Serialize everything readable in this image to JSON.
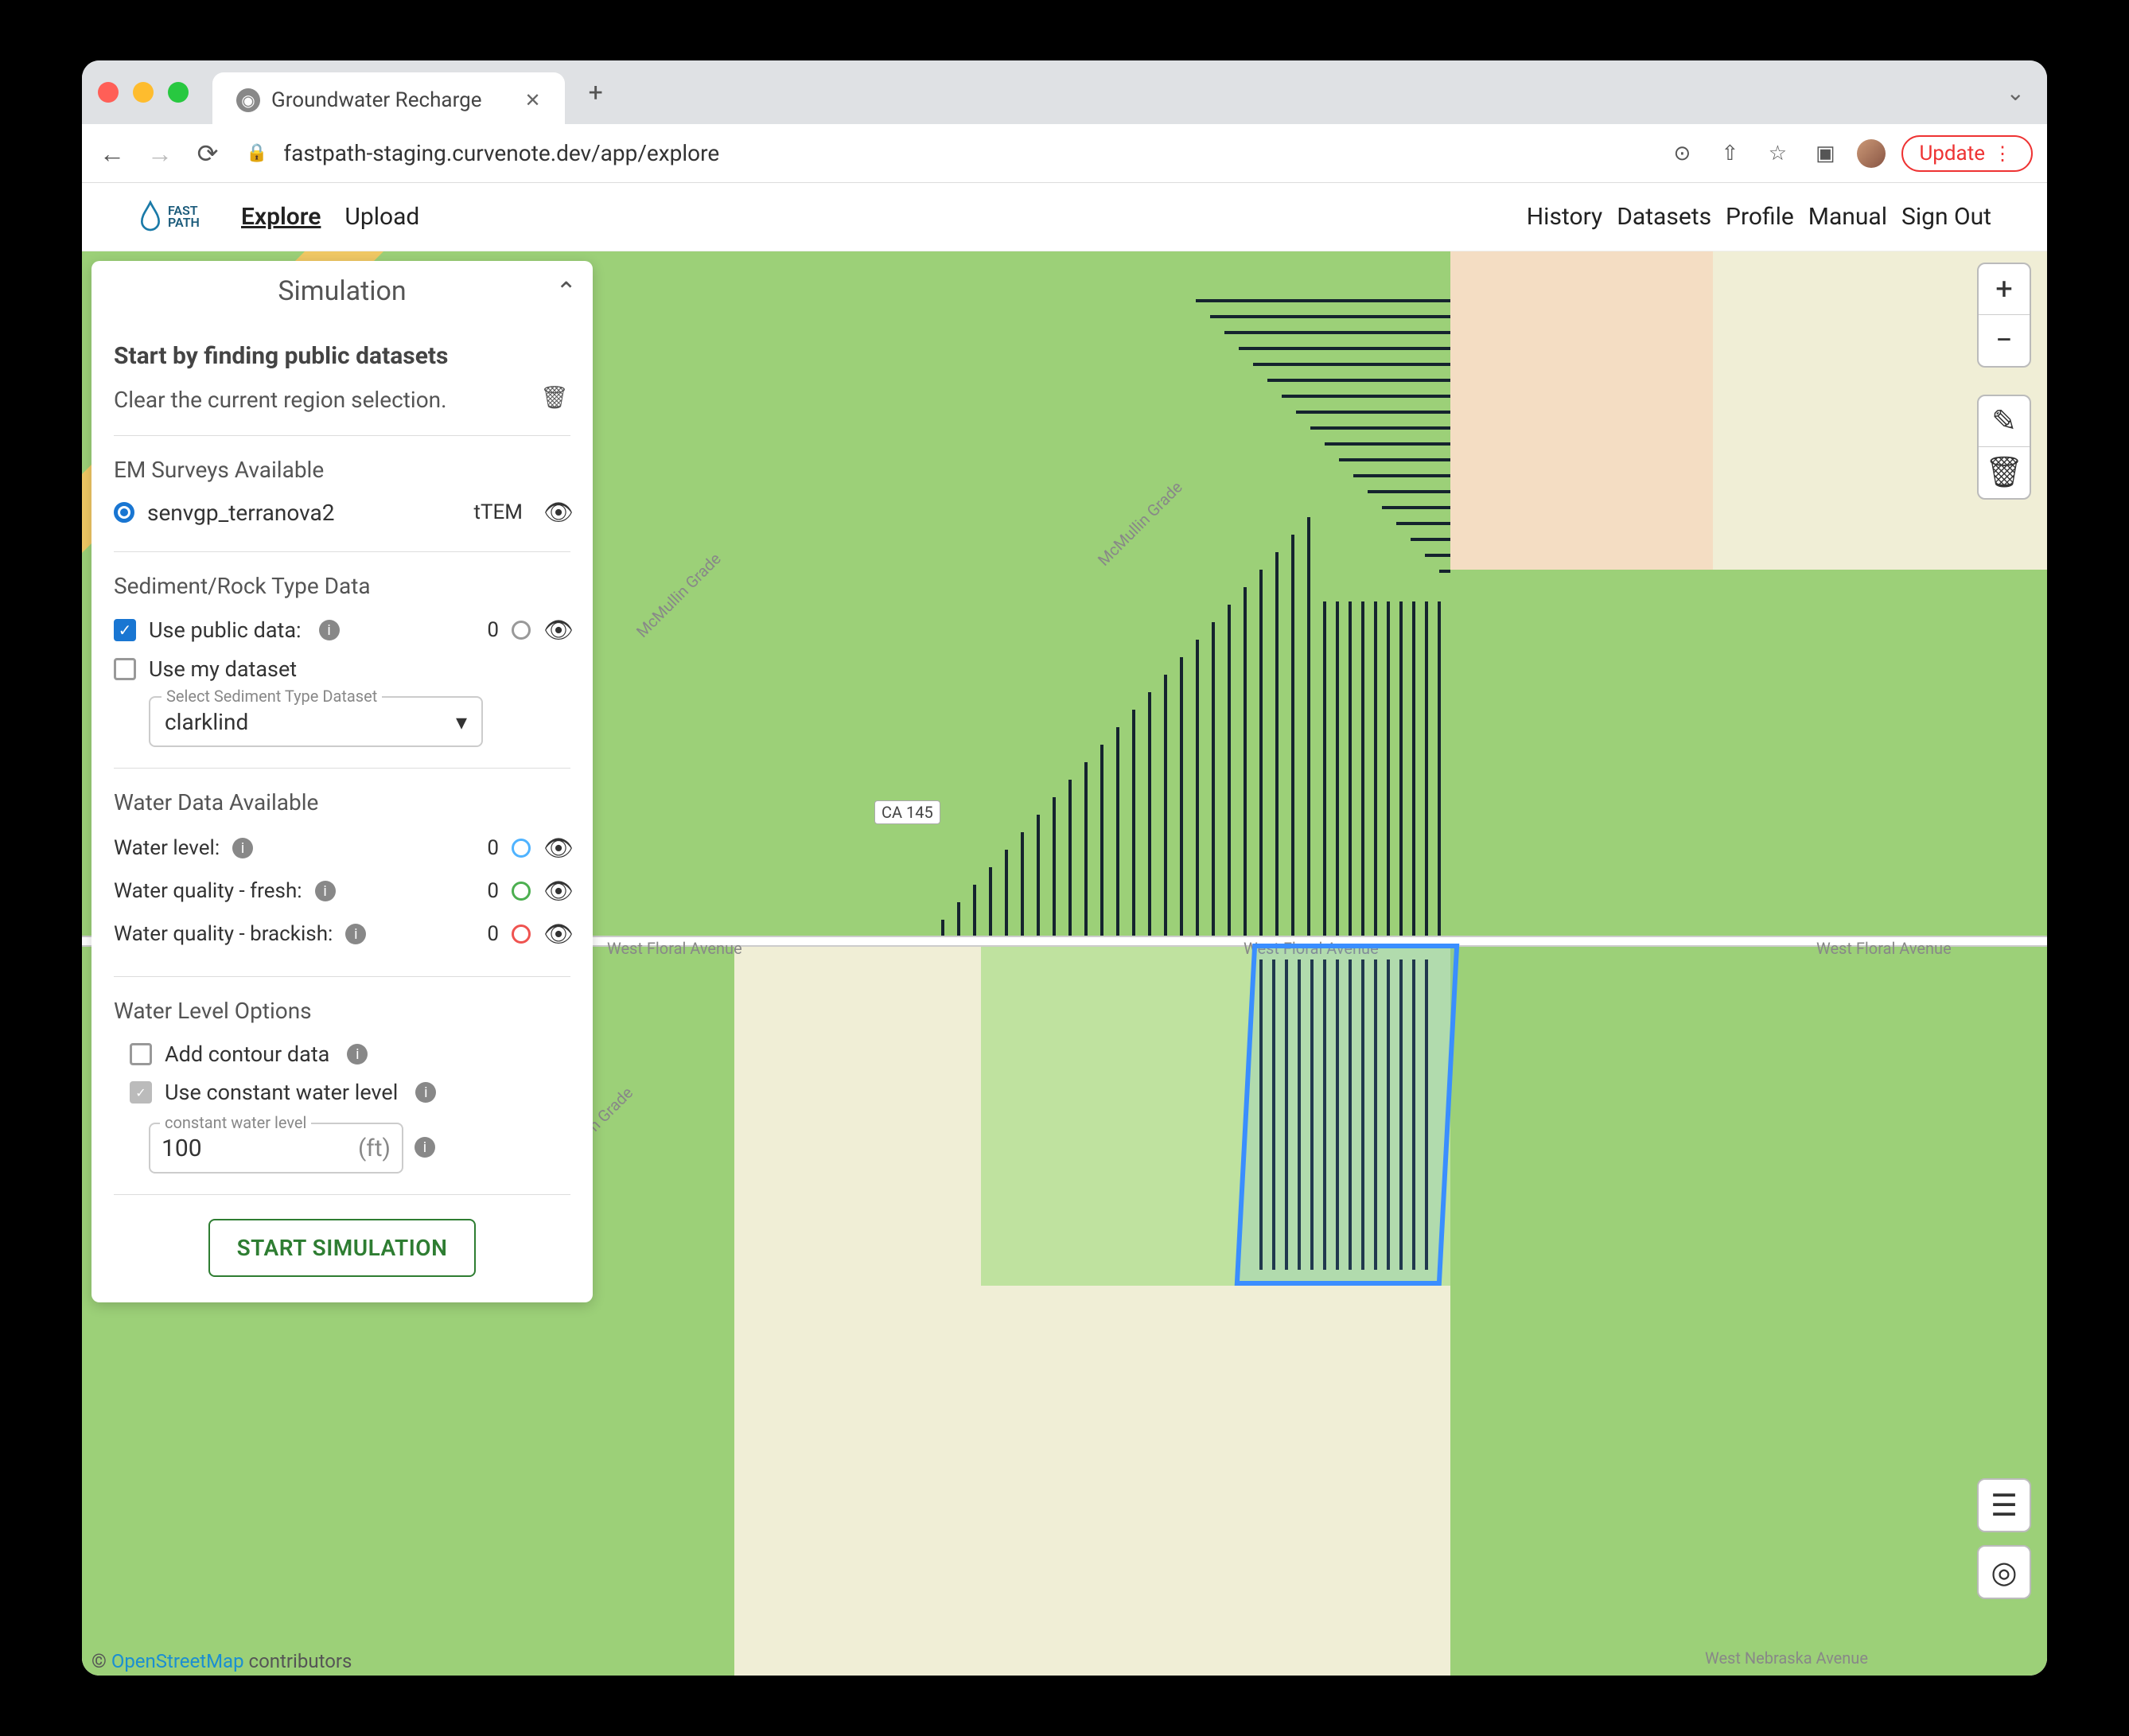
{
  "browser": {
    "tab_title": "Groundwater Recharge",
    "url": "fastpath-staging.curvenote.dev/app/explore",
    "update_label": "Update"
  },
  "header": {
    "brand": "FAST PATH",
    "nav": {
      "explore": "Explore",
      "upload": "Upload"
    },
    "rightnav": {
      "history": "History",
      "datasets": "Datasets",
      "profile": "Profile",
      "manual": "Manual",
      "signout": "Sign Out"
    }
  },
  "panel": {
    "title": "Simulation",
    "intro": "Start by finding public datasets",
    "clear_region": "Clear the current region selection.",
    "em_heading": "EM Surveys Available",
    "em_survey": {
      "name": "senvgp_terranova2",
      "type": "tTEM"
    },
    "sediment_heading": "Sediment/Rock Type Data",
    "use_public": "Use public data:",
    "public_count": "0",
    "use_my": "Use my dataset",
    "sediment_select_label": "Select Sediment Type Dataset",
    "sediment_select_value": "clarklind",
    "water_heading": "Water Data Available",
    "water_level": {
      "label": "Water level:",
      "count": "0"
    },
    "water_fresh": {
      "label": "Water quality - fresh:",
      "count": "0"
    },
    "water_brackish": {
      "label": "Water quality - brackish:",
      "count": "0"
    },
    "wlo_heading": "Water Level Options",
    "add_contour": "Add contour data",
    "use_constant": "Use constant water level",
    "constant_label": "constant water level",
    "constant_value": "100",
    "constant_unit": "(ft)",
    "start": "START SIMULATION"
  },
  "map": {
    "roads": {
      "floral": "West Floral Avenue",
      "nebraska": "West Nebraska Avenue",
      "mcmullin": "McMullin Grade",
      "ca145": "CA 145"
    },
    "attribution_prefix": "© ",
    "attribution_link": "OpenStreetMap",
    "attribution_suffix": " contributors"
  }
}
